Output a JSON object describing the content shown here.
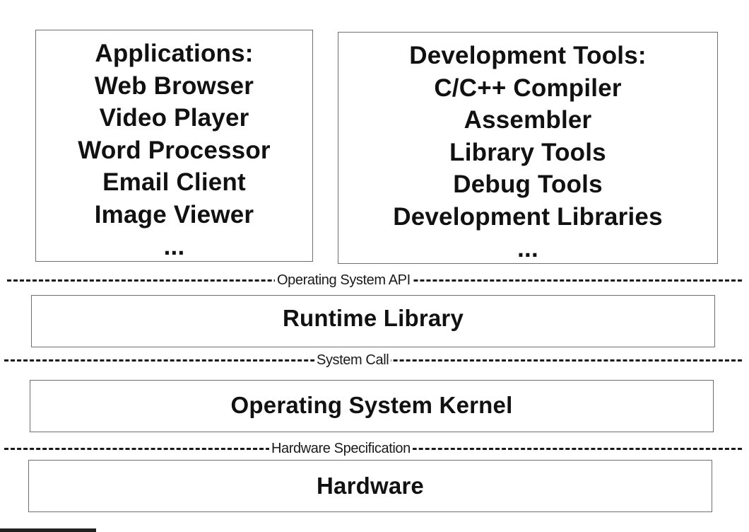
{
  "applications": {
    "title": "Applications:",
    "items": [
      "Web Browser",
      "Video Player",
      "Word Processor",
      "Email Client",
      "Image Viewer",
      "..."
    ]
  },
  "development_tools": {
    "title": "Development Tools:",
    "items": [
      "C/C++ Compiler",
      "Assembler",
      "Library Tools",
      "Debug Tools",
      "Development Libraries",
      "..."
    ]
  },
  "interfaces": {
    "os_api": "Operating System API",
    "system_call": "System Call",
    "hardware_spec": "Hardware Specification"
  },
  "layers": {
    "runtime_library": "Runtime Library",
    "kernel": "Operating System Kernel",
    "hardware": "Hardware"
  }
}
